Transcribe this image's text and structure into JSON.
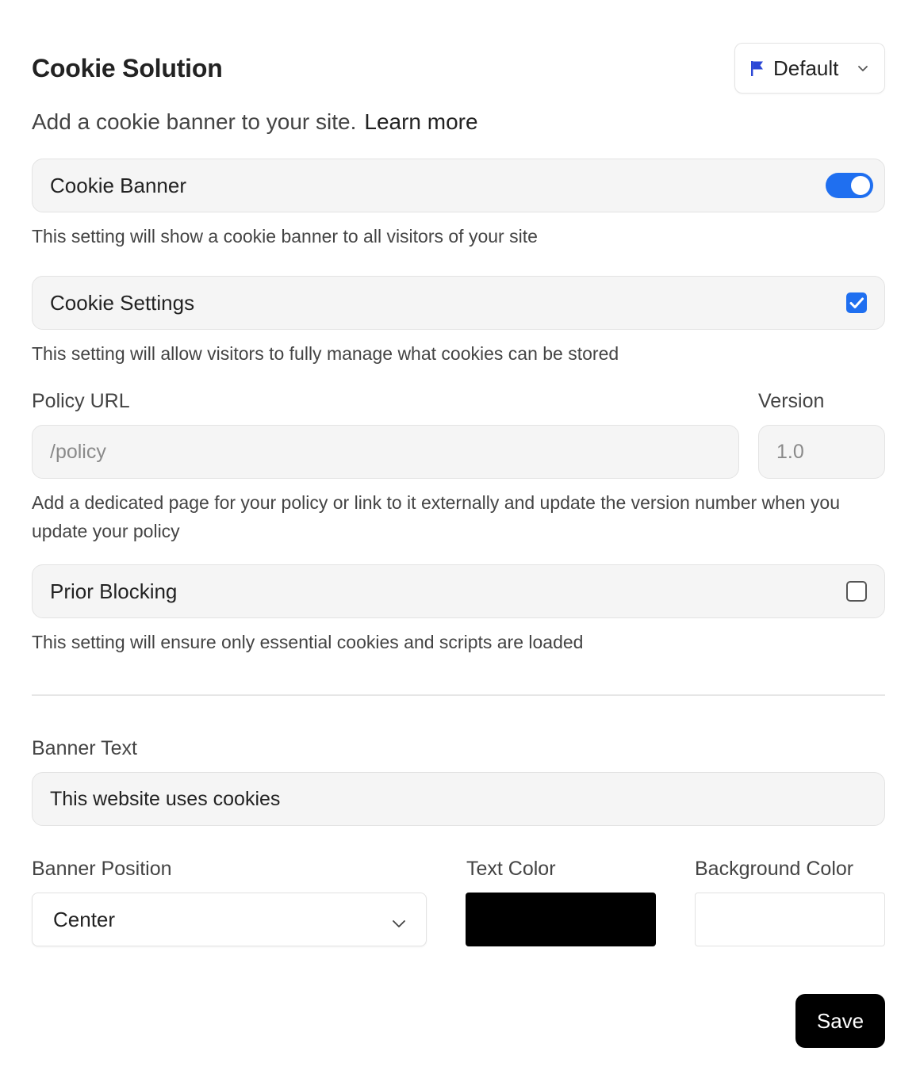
{
  "header": {
    "title": "Cookie Solution",
    "locale": {
      "label": "Default",
      "icon": "flag-icon",
      "accent": "#2b47d6"
    }
  },
  "intro": {
    "text": "Add a cookie banner to your site.",
    "link": "Learn more"
  },
  "cookie_banner": {
    "label": "Cookie Banner",
    "enabled": true,
    "help": "This setting will show a cookie banner to all visitors of your site"
  },
  "cookie_settings": {
    "label": "Cookie Settings",
    "checked": true,
    "help": "This setting will allow visitors to fully manage what cookies can be stored"
  },
  "policy": {
    "url_label": "Policy URL",
    "url_placeholder": "/policy",
    "version_label": "Version",
    "version_placeholder": "1.0",
    "help": "Add a dedicated page for your policy or link to it externally and update the version number when you update your policy"
  },
  "prior_blocking": {
    "label": "Prior Blocking",
    "checked": false,
    "help": "This setting will ensure only essential cookies and scripts are loaded"
  },
  "banner": {
    "text_label": "Banner Text",
    "text_value": "This website uses cookies",
    "position_label": "Banner Position",
    "position_value": "Center",
    "text_color_label": "Text Color",
    "text_color": "#000000",
    "background_color_label": "Background Color",
    "background_color": "#ffffff"
  },
  "actions": {
    "save_label": "Save"
  },
  "colors": {
    "accent": "#1f6ff0",
    "primary_button": "#000000"
  }
}
